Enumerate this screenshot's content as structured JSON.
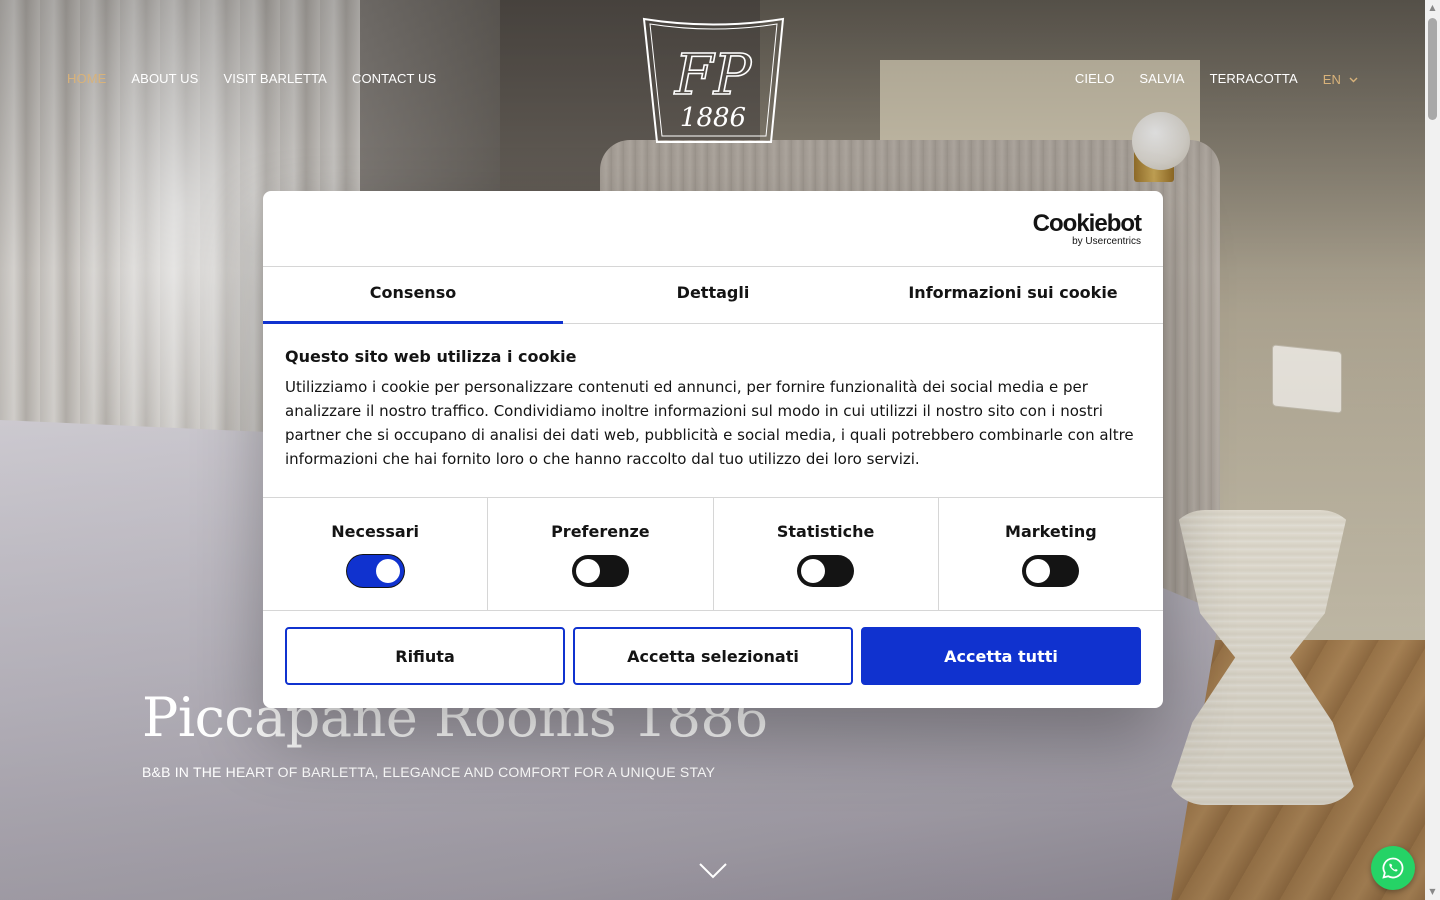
{
  "nav": {
    "left": [
      {
        "label": "HOME",
        "active": true
      },
      {
        "label": "ABOUT US"
      },
      {
        "label": "VISIT BARLETTA"
      },
      {
        "label": "CONTACT US"
      }
    ],
    "right": [
      {
        "label": "CIELO"
      },
      {
        "label": "SALVIA"
      },
      {
        "label": "TERRACOTTA"
      }
    ],
    "language": "EN"
  },
  "logo": {
    "monogram": "FP",
    "year": "1886"
  },
  "hero": {
    "title": "Piccapane Rooms 1886",
    "subtitle": "B&B IN THE HEART OF BARLETTA, ELEGANCE AND COMFORT FOR A UNIQUE STAY"
  },
  "cookie_dialog": {
    "brand": "Cookiebot",
    "brand_sub": "by Usercentrics",
    "tabs": [
      {
        "label": "Consenso",
        "active": true
      },
      {
        "label": "Dettagli"
      },
      {
        "label": "Informazioni sui cookie"
      }
    ],
    "heading": "Questo sito web utilizza i cookie",
    "body": "Utilizziamo i cookie per personalizzare contenuti ed annunci, per fornire funzionalità dei social media e per analizzare il nostro traffico. Condividiamo inoltre informazioni sul modo in cui utilizzi il nostro sito con i nostri partner che si occupano di analisi dei dati web, pubblicità e social media, i quali potrebbero combinarle con altre informazioni che hai fornito loro o che hanno raccolto dal tuo utilizzo dei loro servizi.",
    "toggles": [
      {
        "label": "Necessari",
        "on": true
      },
      {
        "label": "Preferenze",
        "on": false
      },
      {
        "label": "Statistiche",
        "on": false
      },
      {
        "label": "Marketing",
        "on": false
      }
    ],
    "buttons": {
      "reject": "Rifiuta",
      "accept_selected": "Accetta selezionati",
      "accept_all": "Accetta tutti"
    }
  },
  "colors": {
    "accent_gold": "#d8b27a",
    "cookiebot_blue": "#1032cf",
    "whatsapp_green": "#25d366"
  },
  "icons": {
    "scroll_down": "chevron-down-icon",
    "whatsapp": "whatsapp-icon",
    "language_dropdown": "chevron-down-icon"
  }
}
